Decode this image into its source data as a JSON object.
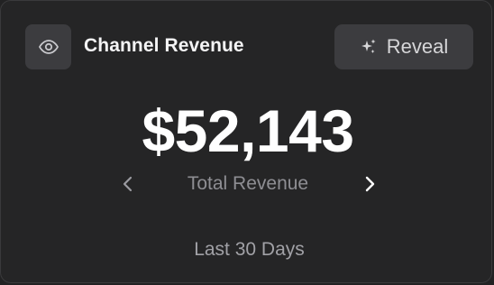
{
  "widget": {
    "title": "Channel Revenue",
    "reveal_label": "Reveal",
    "amount": "$52,143",
    "metric_label": "Total Revenue",
    "period": "Last 30 Days"
  },
  "icons": {
    "visibility": "eye-icon",
    "reveal": "sparkles-icon",
    "previous": "chevron-left-icon",
    "next": "chevron-right-icon"
  },
  "colors": {
    "card_background": "#252526",
    "button_background": "#3c3c3f",
    "primary_text": "#ffffff",
    "secondary_text": "#8e8e93"
  }
}
